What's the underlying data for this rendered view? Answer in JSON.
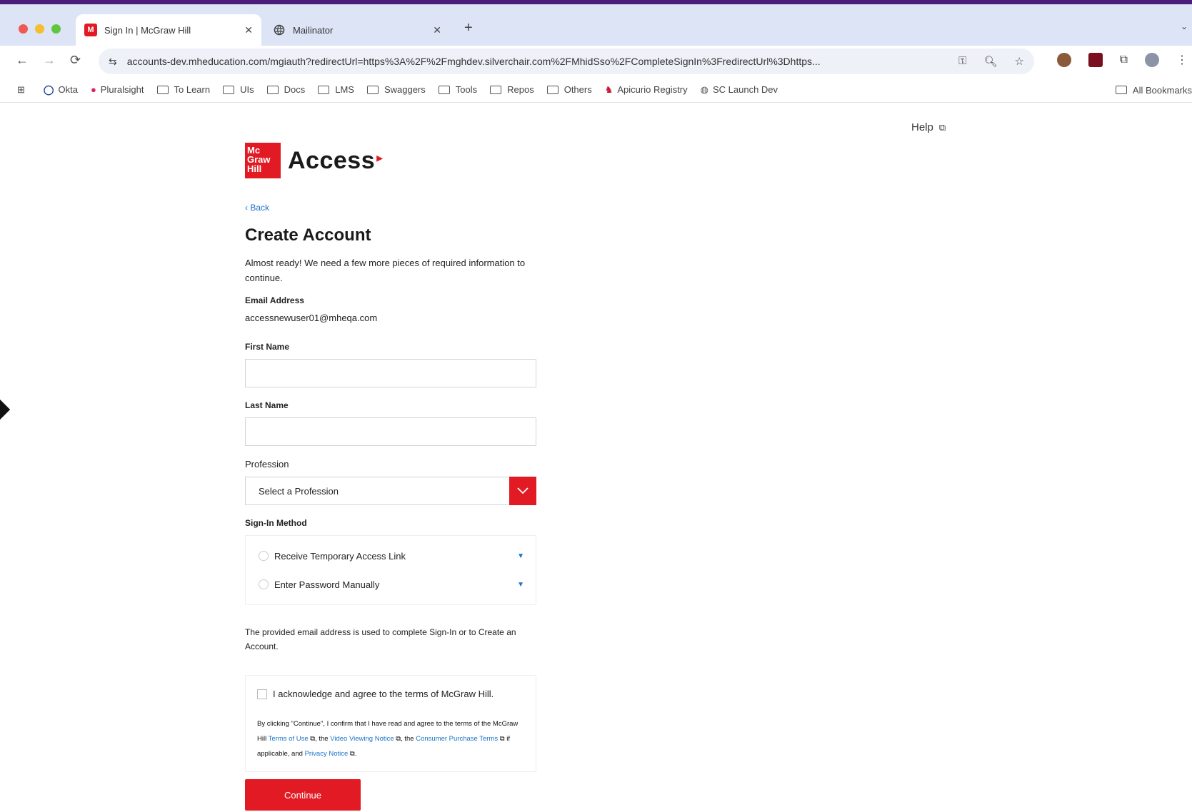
{
  "browser": {
    "tabs": [
      {
        "title": "Sign In | McGraw Hill",
        "favicon": "M",
        "close": "✕"
      },
      {
        "title": "Mailinator",
        "favicon": "globe",
        "close": "✕"
      }
    ],
    "new_tab": "+",
    "url": "accounts-dev.mheducation.com/mgiauth?redirectUrl=https%3A%2F%2Fmghdev.silverchair.com%2FMhidSso%2FCompleteSignIn%3FredirectUrl%3Dhttps...",
    "bookmarks": [
      {
        "label": "Okta",
        "icon": "okta-icon"
      },
      {
        "label": "Pluralsight",
        "icon": "pluralsight-icon"
      },
      {
        "label": "To Learn",
        "icon": "folder-icon"
      },
      {
        "label": "UIs",
        "icon": "folder-icon"
      },
      {
        "label": "Docs",
        "icon": "folder-icon"
      },
      {
        "label": "LMS",
        "icon": "folder-icon"
      },
      {
        "label": "Swaggers",
        "icon": "folder-icon"
      },
      {
        "label": "Tools",
        "icon": "folder-icon"
      },
      {
        "label": "Repos",
        "icon": "folder-icon"
      },
      {
        "label": "Others",
        "icon": "folder-icon"
      },
      {
        "label": "Apicurio Registry",
        "icon": "apicurio-icon"
      },
      {
        "label": "SC Launch Dev",
        "icon": "globe-icon"
      }
    ],
    "all_bookmarks": "All Bookmarks"
  },
  "page": {
    "help": "Help",
    "logo": {
      "box_lines": [
        "Mc",
        "Graw",
        "Hill"
      ],
      "word": "Access"
    },
    "back": "‹ Back",
    "title": "Create Account",
    "intro": "Almost ready! We need a few more pieces of required information to continue.",
    "email_label": "Email Address",
    "email_value": "accessnewuser01@mheqa.com",
    "first_name_label": "First Name",
    "last_name_label": "Last Name",
    "profession_label": "Profession",
    "profession_value": "Select a Profession",
    "signin_label": "Sign-In Method",
    "methods": [
      "Receive Temporary Access Link",
      "Enter Password Manually"
    ],
    "notice": "The provided email address is used to complete Sign-In or to Create an Account.",
    "ack": "I acknowledge and agree to the terms of McGraw Hill.",
    "fine": {
      "p1": "By clicking \"Continue\", I confirm that I have read and agree to the terms of the McGraw Hill ",
      "l1": "Terms of Use",
      "p2": ", the ",
      "l2": "Video Viewing Notice",
      "p3": ", the ",
      "l3": "Consumer Purchase Terms",
      "p4": " if applicable, and ",
      "l4": "Privacy Notice",
      "p5": "."
    },
    "continue": "Continue"
  },
  "colors": {
    "brand_red": "#e21a23",
    "link_blue": "#1a73c8",
    "tab_strip": "#dce4f5",
    "top_bar": "#4b1d7a"
  }
}
